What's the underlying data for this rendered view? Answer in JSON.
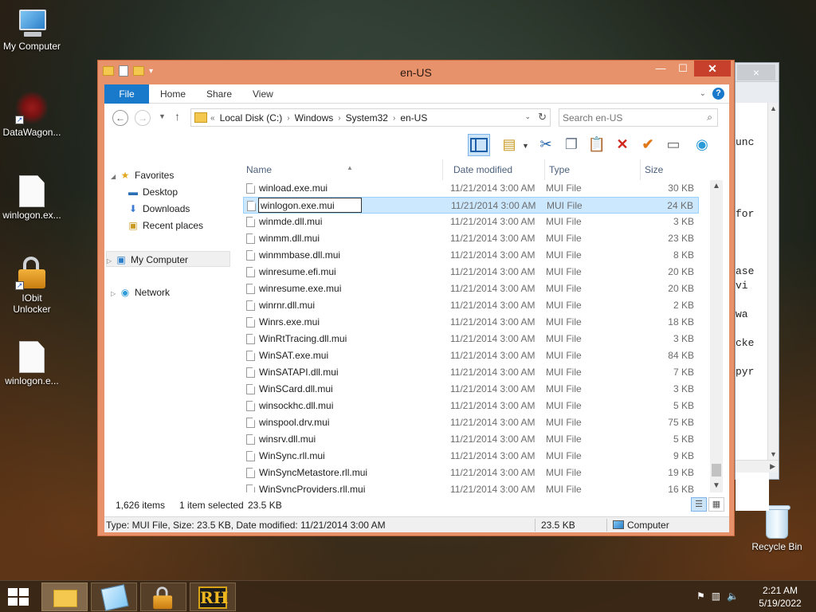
{
  "desktop": {
    "icons": [
      {
        "label": "My Computer",
        "icon": "computer-icon"
      },
      {
        "label": "DataWagon...",
        "icon": "datawagon-icon"
      },
      {
        "label": "winlogon.ex...",
        "icon": "file-icon"
      },
      {
        "label": "IObit Unlocker",
        "icon": "lock-icon"
      },
      {
        "label": "winlogon.e...",
        "icon": "file-icon"
      },
      {
        "label": "Recycle Bin",
        "icon": "recycle-bin-icon"
      }
    ]
  },
  "background_window": {
    "close_glyph": "×",
    "text_fragments": [
      "unc",
      "for",
      "ase",
      " vi",
      " wa",
      "cke",
      "pyr"
    ]
  },
  "window": {
    "title": "en-US",
    "minimize_glyph": "—",
    "maximize_glyph": "☐",
    "close_glyph": "✕",
    "accent_color": "#e8926c"
  },
  "ribbon": {
    "tabs": [
      "File",
      "Home",
      "Share",
      "View"
    ]
  },
  "address_bar": {
    "prefix": "«",
    "crumbs": [
      "Local Disk (C:)",
      "Windows",
      "System32",
      "en-US"
    ]
  },
  "search": {
    "placeholder": "Search en-US"
  },
  "nav_pane": {
    "favorites": "Favorites",
    "desktop": "Desktop",
    "downloads": "Downloads",
    "recent": "Recent places",
    "my_computer": "My Computer",
    "network": "Network"
  },
  "columns": {
    "name": "Name",
    "date": "Date modified",
    "type": "Type",
    "size": "Size"
  },
  "files": [
    {
      "name": "winload.exe.mui",
      "date": "11/21/2014 3:00 AM",
      "type": "MUI File",
      "size": "30 KB"
    },
    {
      "name": "winlogon.exe.mui",
      "date": "11/21/2014 3:00 AM",
      "type": "MUI File",
      "size": "24 KB"
    },
    {
      "name": "winmde.dll.mui",
      "date": "11/21/2014 3:00 AM",
      "type": "MUI File",
      "size": "3 KB"
    },
    {
      "name": "winmm.dll.mui",
      "date": "11/21/2014 3:00 AM",
      "type": "MUI File",
      "size": "23 KB"
    },
    {
      "name": "winmmbase.dll.mui",
      "date": "11/21/2014 3:00 AM",
      "type": "MUI File",
      "size": "8 KB"
    },
    {
      "name": "winresume.efi.mui",
      "date": "11/21/2014 3:00 AM",
      "type": "MUI File",
      "size": "20 KB"
    },
    {
      "name": "winresume.exe.mui",
      "date": "11/21/2014 3:00 AM",
      "type": "MUI File",
      "size": "20 KB"
    },
    {
      "name": "winrnr.dll.mui",
      "date": "11/21/2014 3:00 AM",
      "type": "MUI File",
      "size": "2 KB"
    },
    {
      "name": "Winrs.exe.mui",
      "date": "11/21/2014 3:00 AM",
      "type": "MUI File",
      "size": "18 KB"
    },
    {
      "name": "WinRtTracing.dll.mui",
      "date": "11/21/2014 3:00 AM",
      "type": "MUI File",
      "size": "3 KB"
    },
    {
      "name": "WinSAT.exe.mui",
      "date": "11/21/2014 3:00 AM",
      "type": "MUI File",
      "size": "84 KB"
    },
    {
      "name": "WinSATAPI.dll.mui",
      "date": "11/21/2014 3:00 AM",
      "type": "MUI File",
      "size": "7 KB"
    },
    {
      "name": "WinSCard.dll.mui",
      "date": "11/21/2014 3:00 AM",
      "type": "MUI File",
      "size": "3 KB"
    },
    {
      "name": "winsockhc.dll.mui",
      "date": "11/21/2014 3:00 AM",
      "type": "MUI File",
      "size": "5 KB"
    },
    {
      "name": "winspool.drv.mui",
      "date": "11/21/2014 3:00 AM",
      "type": "MUI File",
      "size": "75 KB"
    },
    {
      "name": "winsrv.dll.mui",
      "date": "11/21/2014 3:00 AM",
      "type": "MUI File",
      "size": "5 KB"
    },
    {
      "name": "WinSync.rll.mui",
      "date": "11/21/2014 3:00 AM",
      "type": "MUI File",
      "size": "9 KB"
    },
    {
      "name": "WinSyncMetastore.rll.mui",
      "date": "11/21/2014 3:00 AM",
      "type": "MUI File",
      "size": "19 KB"
    },
    {
      "name": "WinSyncProviders.rll.mui",
      "date": "11/21/2014 3:00 AM",
      "type": "MUI File",
      "size": "16 KB"
    }
  ],
  "rename": {
    "value": "winlogon.exe.mui"
  },
  "status": {
    "item_count": "1,626 items",
    "selected": "1 item selected",
    "selected_size": "23.5 KB"
  },
  "detail_bar": {
    "info": "Type: MUI File, Size: 23.5 KB, Date modified: 11/21/2014 3:00 AM",
    "size": "23.5 KB",
    "location": "Computer"
  },
  "taskbar": {
    "rh_label": "RH",
    "clock_time": "2:21 AM",
    "clock_date": "5/19/2022"
  }
}
